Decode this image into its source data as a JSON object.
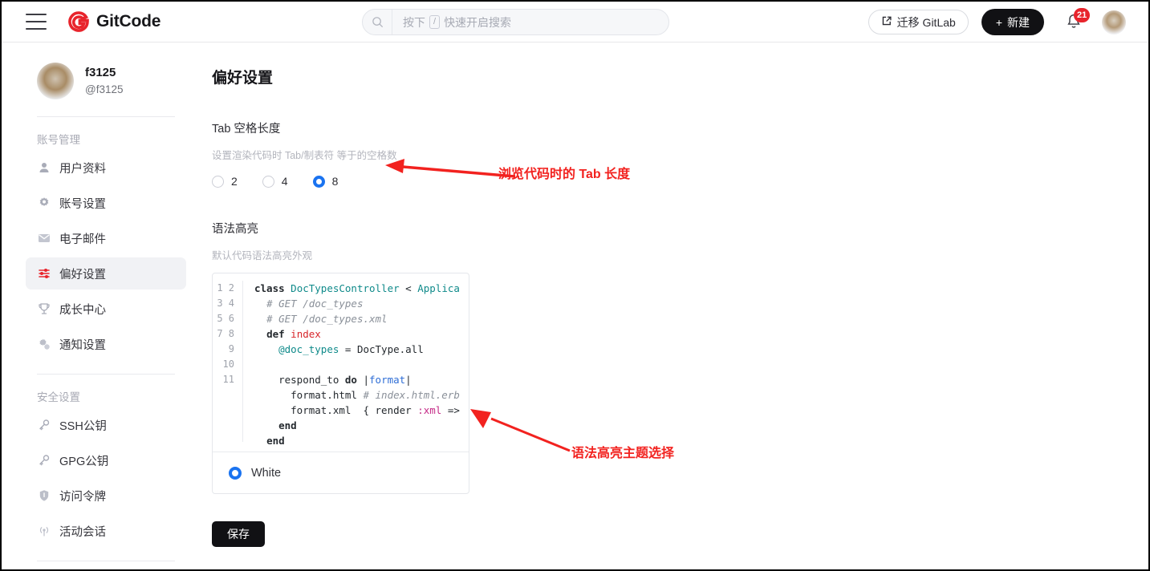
{
  "header": {
    "menu_icon": "hamburger-icon",
    "brand": "GitCode",
    "search": {
      "icon": "search-icon",
      "kbd": "/",
      "prefix": "按下",
      "suffix": "快速开启搜索",
      "placeholder": "按下 / 快速开启搜索",
      "value": ""
    },
    "migrate_label": "迁移 GitLab",
    "new_label": "新建",
    "new_plus": "+",
    "bell_icon": "bell-icon",
    "notification_count": "21",
    "avatar": "user-avatar"
  },
  "sidebar": {
    "profile": {
      "name": "f3125",
      "handle": "@f3125"
    },
    "sections": [
      {
        "title": "账号管理",
        "items": [
          {
            "label": "用户资料",
            "icon": "user-icon",
            "active": false
          },
          {
            "label": "账号设置",
            "icon": "gear-icon",
            "active": false
          },
          {
            "label": "电子邮件",
            "icon": "mail-icon",
            "active": false
          },
          {
            "label": "偏好设置",
            "icon": "sliders-icon",
            "active": true
          },
          {
            "label": "成长中心",
            "icon": "trophy-icon",
            "active": false
          },
          {
            "label": "通知设置",
            "icon": "bell-gear-icon",
            "active": false
          }
        ]
      },
      {
        "title": "安全设置",
        "items": [
          {
            "label": "SSH公钥",
            "icon": "key-icon",
            "active": false
          },
          {
            "label": "GPG公钥",
            "icon": "key-icon",
            "active": false
          },
          {
            "label": "访问令牌",
            "icon": "shield-icon",
            "active": false
          },
          {
            "label": "活动会话",
            "icon": "broadcast-icon",
            "active": false
          }
        ]
      }
    ]
  },
  "main": {
    "title": "偏好设置",
    "tab_setting": {
      "label": "Tab 空格长度",
      "desc": "设置渲染代码时 Tab/制表符 等于的空格数",
      "options": [
        {
          "label": "2",
          "selected": false
        },
        {
          "label": "4",
          "selected": false
        },
        {
          "label": "8",
          "selected": true
        }
      ]
    },
    "syntax": {
      "label": "语法高亮",
      "desc": "默认代码语法高亮外观",
      "line_numbers": [
        "1",
        "2",
        "3",
        "4",
        "5",
        "6",
        "7",
        "8",
        "9",
        "10",
        "11"
      ],
      "code_lines": [
        "class DocTypesController < Applica",
        "  # GET /doc_types",
        "  # GET /doc_types.xml",
        "  def index",
        "    @doc_types = DocType.all",
        "",
        "    respond_to do |format|",
        "      format.html # index.html.erb",
        "      format.xml  { render :xml =>",
        "    end",
        "  end"
      ],
      "theme": {
        "label": "White",
        "selected": true
      }
    },
    "save_label": "保存"
  },
  "annotations": [
    {
      "text": "浏览代码时的 Tab 长度",
      "color": "#f2221f"
    },
    {
      "text": "语法高亮主题选择",
      "color": "#f2221f"
    }
  ]
}
